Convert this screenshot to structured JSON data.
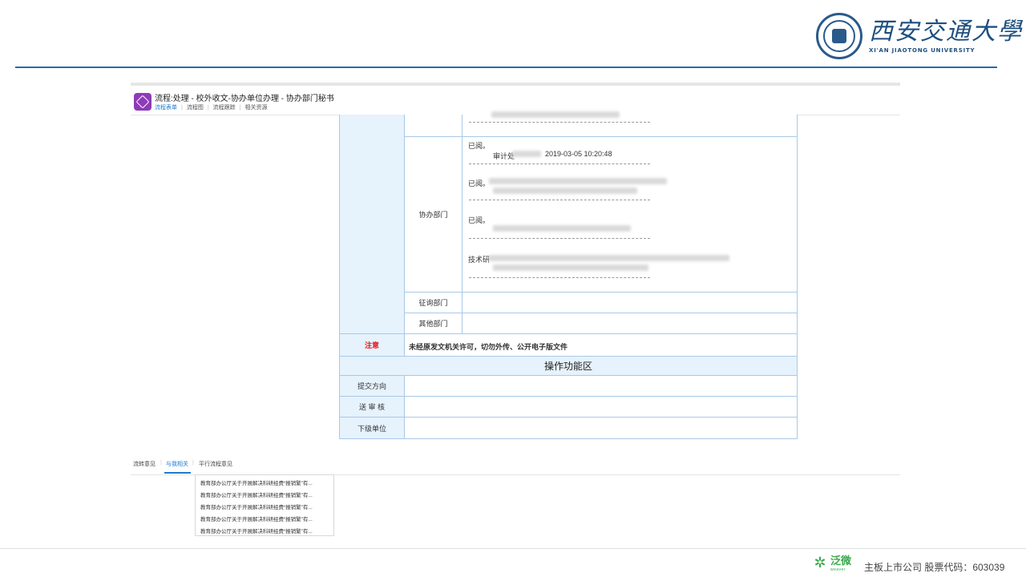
{
  "header": {
    "logo_cn": "西安交通大學",
    "logo_en": "XI'AN JIAOTONG UNIVERSITY"
  },
  "app": {
    "title": "流程:处理 - 校外收文-协办单位办理 - 协办部门秘书",
    "tabs": [
      {
        "label": "流程表单"
      },
      {
        "label": "流程图"
      },
      {
        "label": "流程跟踪"
      },
      {
        "label": "相关资源"
      }
    ]
  },
  "form": {
    "assist_dept_label": "协办部门",
    "opinions": [
      {
        "text": "已阅。",
        "signer": "审计处",
        "time": "2019-03-05 10:20:48"
      },
      {
        "text": "已阅。"
      },
      {
        "text": "已阅。"
      },
      {
        "text": "技术研"
      }
    ],
    "consult_dept_label": "征询部门",
    "other_dept_label": "其他部门",
    "notice_label": "注意",
    "notice_text": "未经原发文机关许可，切勿外传、公开电子版文件",
    "ops_header": "操作功能区",
    "ops_rows": [
      {
        "label": "提交方向"
      },
      {
        "label": "送 审 核"
      },
      {
        "label": "下级单位"
      }
    ]
  },
  "bottom": {
    "tabs": [
      {
        "label": "流转意见"
      },
      {
        "label": "与我相关"
      },
      {
        "label": "平行流程意见"
      }
    ],
    "related_items": [
      "教育部办公厅关于开展解决科研经费“报销繁”有...",
      "教育部办公厅关于开展解决科研经费“报销繁”有...",
      "教育部办公厅关于开展解决科研经费“报销繁”有...",
      "教育部办公厅关于开展解决科研经费“报销繁”有...",
      "教育部办公厅关于开展解决科研经费“报销繁”有..."
    ]
  },
  "footer": {
    "brand": "泛微",
    "brand_en": "weaver",
    "text": "主板上市公司  股票代码：603039"
  },
  "colors": {
    "accent": "#1f7ad1",
    "label_bg": "#e6f2fc",
    "border": "#a9c9e5",
    "notice": "#e02020",
    "brand_green": "#3aa84a",
    "school_blue": "#1d4f80"
  }
}
